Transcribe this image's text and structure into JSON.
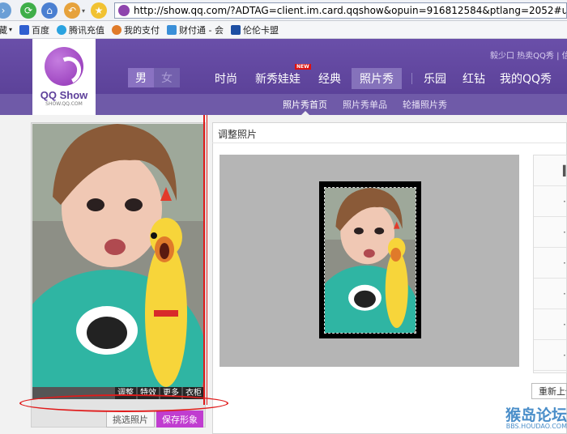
{
  "browser": {
    "url": "http://show.qq.com/?ADTAG=client.im.card.qqshow&opuin=916812584&ptlang=2052#u%3DphotoShow"
  },
  "bookmarks": {
    "items": [
      "藏",
      "百度",
      "腾讯充值",
      "我的支付",
      "财付通 - 会",
      "伦伦卡盟"
    ]
  },
  "qqshow": {
    "logo_text": "QQ Show",
    "logo_sub": "SHOW.QQ.COM",
    "user_links": "毅少口 热卖QQ秀 | 信誉",
    "gender_male": "男",
    "gender_female": "女",
    "nav": [
      "时尚",
      "新秀娃娃",
      "经典",
      "照片秀",
      "乐园",
      "红钻",
      "我的QQ秀"
    ],
    "new_badge": "NEW",
    "subnav": [
      "照片秀首页",
      "照片秀单品",
      "轮播照片秀"
    ]
  },
  "editor": {
    "panel_title": "调整照片",
    "photo_tools": [
      "调整",
      "特效",
      "更多",
      "衣柜"
    ],
    "choose_photo": "挑选照片",
    "save_look": "保存形象",
    "reupload": "重新上传"
  },
  "watermark": {
    "main": "猴岛论坛",
    "sub": "BBS.HOUDAO.COM"
  },
  "colors": {
    "header_purple": "#6a4fa9",
    "save_button": "#c03dd0",
    "annotation_red": "#e01b1b"
  }
}
